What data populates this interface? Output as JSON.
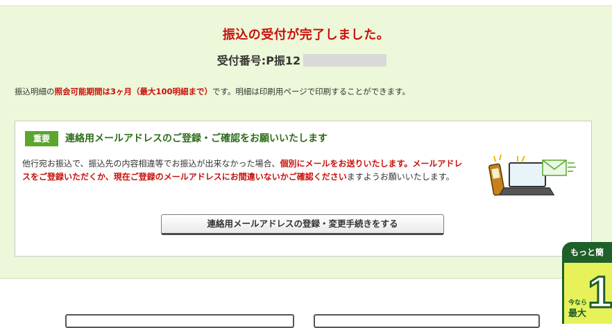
{
  "result": {
    "title": "振込の受付が完了しました。",
    "receipt_label": "受付番号:P振12"
  },
  "note": {
    "prefix": "振込明細の",
    "highlight": "照会可能期間は3ヶ月（最大100明細まで）",
    "suffix": "です。明細は印刷用ページで印刷することができます。"
  },
  "notice": {
    "badge": "重要",
    "title": "連絡用メールアドレスのご登録・ご確認をお願いいたします",
    "body_plain_1": "他行宛お振込で、振込先の内容相違等でお振込が出来なかった場合、",
    "body_em_1": "個別にメールをお送りいたします。メールアドレスをご登録いただくか、現在ご登録のメールアドレスにお間違いないかご確認ください",
    "body_plain_2": "ますようお願いいたします。",
    "button_label": "連絡用メールアドレスの登録・変更手続きをする",
    "illustration": "phone-laptop-mail-icon"
  },
  "promo": {
    "header": "もっと簡",
    "small": "今なら",
    "big": "最大",
    "number": "1"
  },
  "colors": {
    "panel_bg": "#edf7d9",
    "accent_red": "#c8100a",
    "badge_green": "#5ca52f",
    "title_green": "#2e6d1a",
    "promo_dark": "#1f5f2a",
    "promo_yellow": "#e7f25a"
  }
}
